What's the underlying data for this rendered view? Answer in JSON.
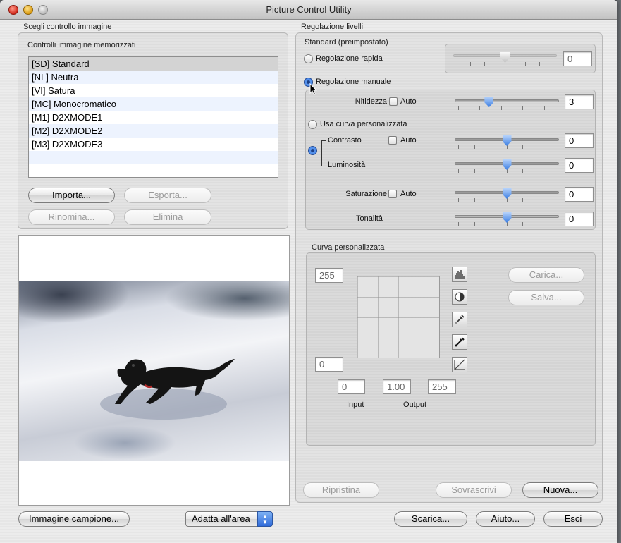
{
  "window": {
    "title": "Picture Control Utility"
  },
  "left": {
    "section_title": "Scegli controllo immagine",
    "list_title": "Controlli immagine memorizzati",
    "items": [
      "[SD] Standard",
      "[NL] Neutra",
      "[VI] Satura",
      "[MC] Monocromatico",
      "[M1] D2XMODE1",
      "[M2] D2XMODE2",
      "[M3] D2XMODE3"
    ],
    "selected_index": 0,
    "buttons": {
      "import": "Importa...",
      "export": "Esporta...",
      "rename": "Rinomina...",
      "delete": "Elimina"
    }
  },
  "right": {
    "section_title": "Regolazione livelli",
    "subtitle": "Standard (preimpostato)",
    "quick": {
      "label": "Regolazione rapida",
      "value": "0",
      "position": 0.5
    },
    "manual": {
      "label": "Regolazione manuale"
    },
    "sharpness": {
      "label": "Nitidezza",
      "auto_label": "Auto",
      "value": "3",
      "position": 0.33
    },
    "custom_curve_option": {
      "label": "Usa curva personalizzata"
    },
    "contrast": {
      "label": "Contrasto",
      "auto_label": "Auto",
      "value": "0",
      "position": 0.5
    },
    "brightness": {
      "label": "Luminosità",
      "value": "0",
      "position": 0.5
    },
    "saturation": {
      "label": "Saturazione",
      "auto_label": "Auto",
      "value": "0",
      "position": 0.5
    },
    "hue": {
      "label": "Tonalità",
      "value": "0",
      "position": 0.5
    }
  },
  "curve": {
    "section_title": "Curva personalizzata",
    "top_value": "255",
    "bottom_value": "0",
    "input_black": "0",
    "gamma": "1.00",
    "input_white": "255",
    "input_label": "Input",
    "output_label": "Output",
    "load_button": "Carica...",
    "save_button": "Salva..."
  },
  "bottom_right": {
    "reset": "Ripristina",
    "overwrite": "Sovrascrivi",
    "new": "Nuova..."
  },
  "footer": {
    "sample_image": "Immagine campione...",
    "fit_option": "Adatta all'area",
    "download": "Scarica...",
    "help": "Aiuto...",
    "exit": "Esci"
  },
  "colors": {
    "accent": "#3a7de2",
    "window_bg": "#ececec"
  }
}
